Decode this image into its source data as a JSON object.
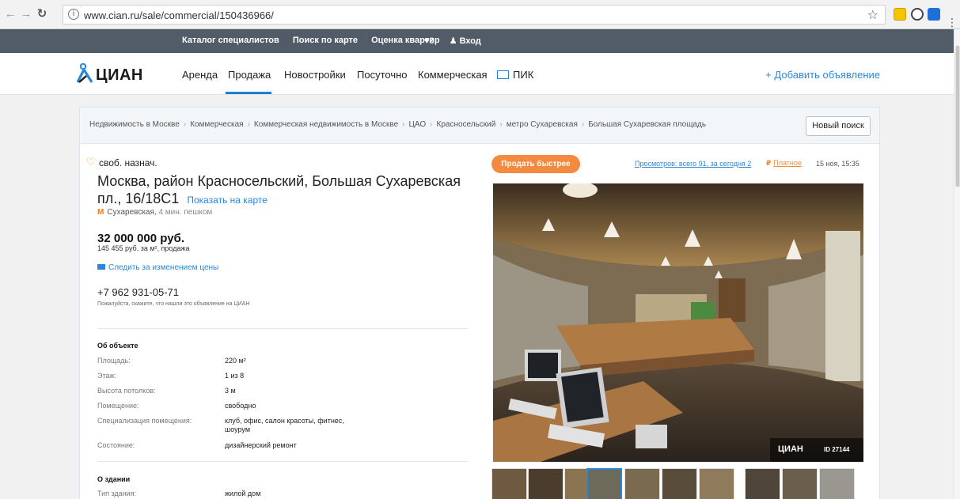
{
  "browser": {
    "url": "www.cian.ru/sale/commercial/150436966/",
    "back_icon": "arrow-left-icon",
    "forward_icon": "arrow-right-icon",
    "reload_icon": "reload-icon",
    "info_icon": "info-icon",
    "bookmark_icon": "star-icon"
  },
  "topbar": {
    "links": [
      "Каталог специалистов",
      "Поиск по карте",
      "Оценка квартир"
    ],
    "favorites": "♥0",
    "login": "Вход"
  },
  "header": {
    "logo": "ЦИАН",
    "menu": [
      "Аренда",
      "Продажа",
      "Новостройки",
      "Посуточно",
      "Коммерческая",
      "ПИК"
    ],
    "active_menu": "Продажа",
    "add_ad": "+ Добавить объявление"
  },
  "breadcrumbs": [
    "Недвижимость в Москве",
    "Коммерческая",
    "Коммерческая недвижимость в Москве",
    "ЦАО",
    "Красносельский",
    "метро Сухаревская",
    "Большая Сухаревская площадь"
  ],
  "new_search": "Новый поиск",
  "listing": {
    "category": "своб. назнач.",
    "address": "Москва, район Красносельский, Большая Сухаревская пл., 16/18С1",
    "show_on_map": "Показать на карте",
    "metro_icon": "М",
    "metro": "Сухаревская,",
    "walk": "4 мин. пешком",
    "price": "32 000 000 руб.",
    "price_sub": "145 455 руб. за м², продажа",
    "follow_price": "Следить за изменением цены",
    "phone": "+7 962 931-05-71",
    "phone_note": "Пожалуйста, скажите, что нашли это объявление на ЦИАН"
  },
  "about_object": {
    "title": "Об объекте",
    "rows": [
      {
        "k": "Площадь:",
        "v": "220 м²"
      },
      {
        "k": "Этаж:",
        "v": "1 из 8"
      },
      {
        "k": "Высота потолков:",
        "v": "3 м"
      },
      {
        "k": "Помещение:",
        "v": "свободно"
      },
      {
        "k": "Специализация помещения:",
        "v": "клуб, офис, салон красоты, фитнес, шоурум"
      },
      {
        "k": "Состояние:",
        "v": "дизайнерский ремонт"
      }
    ]
  },
  "about_building": {
    "title": "О здании",
    "rows": [
      {
        "k": "Тип здания:",
        "v": "жилой дом"
      }
    ]
  },
  "right_panel": {
    "sell_fast": "Продать быстрее",
    "views": "Просмотров: всего 91, за сегодня 2",
    "paid_icon": "₽",
    "paid": "Платное",
    "date": "15 ноя, 15:35",
    "watermark_logo": "ЦИАН",
    "watermark_id": "ID 27144"
  },
  "colors": {
    "topbar": "#515c68",
    "accent_blue": "#2b87db",
    "accent_orange": "#f38a3f"
  }
}
